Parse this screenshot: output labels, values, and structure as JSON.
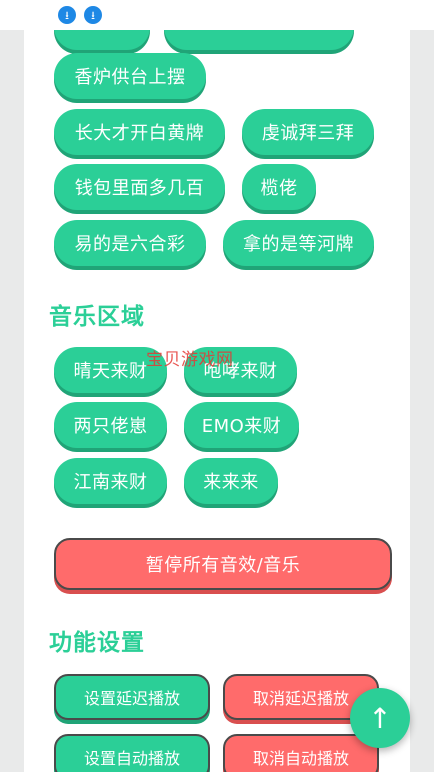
{
  "topbar": {
    "icons": [
      "download-icon",
      "download-icon"
    ]
  },
  "tags": [
    "香炉供台上摆",
    "长大才开白黄牌",
    "虔诚拜三拜",
    "钱包里面多几百",
    "榄佬",
    "易的是六合彩",
    "拿的是等河牌"
  ],
  "music_section": {
    "title": "音乐区域",
    "items": [
      "晴天来财",
      "咆哮来财",
      "两只佬崽",
      "EMO来财",
      "江南来财",
      "来来来"
    ]
  },
  "stop_all_label": "暂停所有音效/音乐",
  "settings_section": {
    "title": "功能设置",
    "buttons": [
      "设置延迟播放",
      "取消延迟播放",
      "设置自动播放",
      "取消自动播放"
    ]
  },
  "watermark": "宝贝游戏网",
  "fab_icon": "↑",
  "colors": {
    "accent": "#2bcf97",
    "danger": "#ff6b6b",
    "background": "#e9eaea"
  }
}
